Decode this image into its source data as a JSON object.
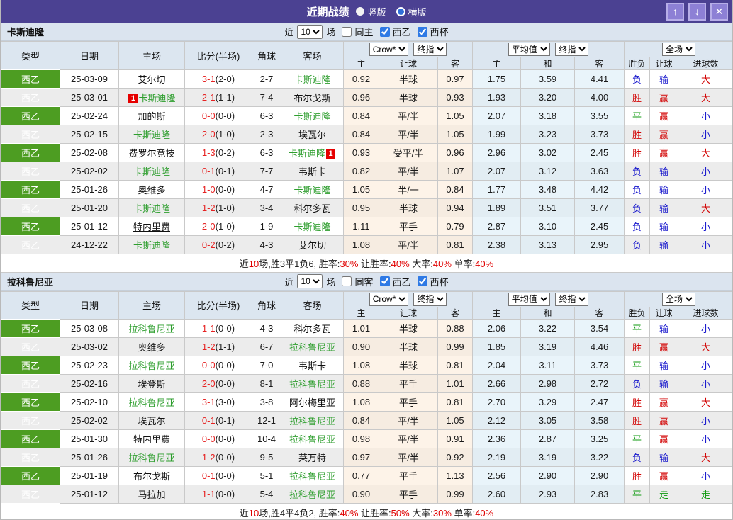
{
  "colors": {
    "purple": "#4b4192",
    "team_green": "#2e9e2e",
    "score_red": "#e62222",
    "badge_red": "#e60000",
    "summary_red": "#e00000",
    "result_red": "#d20000",
    "result_blue": "#1414cc",
    "result_green": "#0f9a0f"
  },
  "result_color_map": {
    "胜": "red",
    "赢": "red",
    "大": "red",
    "负": "blue",
    "输": "blue",
    "小": "blue",
    "平": "green",
    "走": "green"
  },
  "topbar": {
    "title": "近期战绩",
    "radio_vertical": "竖版",
    "radio_horizontal": "横版",
    "btn_up": "↑",
    "btn_down": "↓",
    "btn_close": "✕"
  },
  "headers": {
    "cols": [
      "类型",
      "日期",
      "主场",
      "比分(半场)",
      "角球",
      "客场"
    ],
    "odds_source": "Crow*",
    "odds_time": "终指",
    "avg_label": "平均值",
    "avg_time": "终指",
    "fulltime": "全场",
    "odds_cols": [
      "主",
      "让球",
      "客"
    ],
    "avg_cols": [
      "主",
      "和",
      "客"
    ],
    "result_cols": [
      "胜负",
      "让球",
      "进球数"
    ]
  },
  "sections": [
    {
      "team": "卡斯迪隆",
      "filter": {
        "prefix": "近",
        "count": "10",
        "suffix": "场",
        "same_label": "同主",
        "same_checked": false,
        "league_label": "西乙",
        "league_checked": true,
        "cup_label": "西杯",
        "cup_checked": true
      },
      "rows": [
        {
          "league": "西乙",
          "date": "25-03-09",
          "home": {
            "name": "艾尔切",
            "green": false
          },
          "score": "3-1",
          "half": "(2-0)",
          "corner": "2-7",
          "away": {
            "name": "卡斯迪隆",
            "green": true
          },
          "odds": [
            "0.92",
            "半球",
            "0.97"
          ],
          "avg": [
            "1.75",
            "3.59",
            "4.41"
          ],
          "results": [
            "负",
            "输",
            "大"
          ]
        },
        {
          "league": "西乙",
          "date": "25-03-01",
          "home": {
            "name": "卡斯迪隆",
            "green": true,
            "badge": "before",
            "badge_text": "1"
          },
          "score": "2-1",
          "half": "(1-1)",
          "corner": "7-4",
          "away": {
            "name": "布尔戈斯",
            "green": false
          },
          "odds": [
            "0.96",
            "半球",
            "0.93"
          ],
          "avg": [
            "1.93",
            "3.20",
            "4.00"
          ],
          "results": [
            "胜",
            "赢",
            "大"
          ]
        },
        {
          "league": "西乙",
          "date": "25-02-24",
          "home": {
            "name": "加的斯",
            "green": false
          },
          "score": "0-0",
          "half": "(0-0)",
          "corner": "6-3",
          "away": {
            "name": "卡斯迪隆",
            "green": true
          },
          "odds": [
            "0.84",
            "平/半",
            "1.05"
          ],
          "avg": [
            "2.07",
            "3.18",
            "3.55"
          ],
          "results": [
            "平",
            "赢",
            "小"
          ]
        },
        {
          "league": "西乙",
          "date": "25-02-15",
          "home": {
            "name": "卡斯迪隆",
            "green": true
          },
          "score": "2-0",
          "half": "(1-0)",
          "corner": "2-3",
          "away": {
            "name": "埃瓦尔",
            "green": false
          },
          "odds": [
            "0.84",
            "平/半",
            "1.05"
          ],
          "avg": [
            "1.99",
            "3.23",
            "3.73"
          ],
          "results": [
            "胜",
            "赢",
            "小"
          ]
        },
        {
          "league": "西乙",
          "date": "25-02-08",
          "home": {
            "name": "费罗尔竞技",
            "green": false
          },
          "score": "1-3",
          "half": "(0-2)",
          "corner": "6-3",
          "away": {
            "name": "卡斯迪隆",
            "green": true,
            "badge": "after",
            "badge_text": "1"
          },
          "odds": [
            "0.93",
            "受平/半",
            "0.96"
          ],
          "avg": [
            "2.96",
            "3.02",
            "2.45"
          ],
          "results": [
            "胜",
            "赢",
            "大"
          ]
        },
        {
          "league": "西乙",
          "date": "25-02-02",
          "home": {
            "name": "卡斯迪隆",
            "green": true
          },
          "score": "0-1",
          "half": "(0-1)",
          "corner": "7-7",
          "away": {
            "name": "韦斯卡",
            "green": false
          },
          "odds": [
            "0.82",
            "平/半",
            "1.07"
          ],
          "avg": [
            "2.07",
            "3.12",
            "3.63"
          ],
          "results": [
            "负",
            "输",
            "小"
          ]
        },
        {
          "league": "西乙",
          "date": "25-01-26",
          "home": {
            "name": "奥维多",
            "green": false
          },
          "score": "1-0",
          "half": "(0-0)",
          "corner": "4-7",
          "away": {
            "name": "卡斯迪隆",
            "green": true
          },
          "odds": [
            "1.05",
            "半/一",
            "0.84"
          ],
          "avg": [
            "1.77",
            "3.48",
            "4.42"
          ],
          "results": [
            "负",
            "输",
            "小"
          ]
        },
        {
          "league": "西乙",
          "date": "25-01-20",
          "home": {
            "name": "卡斯迪隆",
            "green": true
          },
          "score": "1-2",
          "half": "(1-0)",
          "corner": "3-4",
          "away": {
            "name": "科尔多瓦",
            "green": false
          },
          "odds": [
            "0.95",
            "半球",
            "0.94"
          ],
          "avg": [
            "1.89",
            "3.51",
            "3.77"
          ],
          "results": [
            "负",
            "输",
            "大"
          ]
        },
        {
          "league": "西乙",
          "date": "25-01-12",
          "home": {
            "name": "特内里费",
            "green": false,
            "underline": true
          },
          "score": "2-0",
          "half": "(1-0)",
          "corner": "1-9",
          "away": {
            "name": "卡斯迪隆",
            "green": true
          },
          "odds": [
            "1.11",
            "平手",
            "0.79"
          ],
          "avg": [
            "2.87",
            "3.10",
            "2.45"
          ],
          "results": [
            "负",
            "输",
            "小"
          ]
        },
        {
          "league": "西乙",
          "date": "24-12-22",
          "home": {
            "name": "卡斯迪隆",
            "green": true
          },
          "score": "0-2",
          "half": "(0-2)",
          "corner": "4-3",
          "away": {
            "name": "艾尔切",
            "green": false
          },
          "odds": [
            "1.08",
            "平/半",
            "0.81"
          ],
          "avg": [
            "2.38",
            "3.13",
            "2.95"
          ],
          "results": [
            "负",
            "输",
            "小"
          ]
        }
      ],
      "summary": [
        {
          "text": "近",
          "red": false
        },
        {
          "text": "10",
          "red": true
        },
        {
          "text": "场,胜3平1负6, 胜率:",
          "red": false
        },
        {
          "text": "30%",
          "red": true
        },
        {
          "text": " 让胜率:",
          "red": false
        },
        {
          "text": "40%",
          "red": true
        },
        {
          "text": " 大率:",
          "red": false
        },
        {
          "text": "40%",
          "red": true
        },
        {
          "text": " 单率:",
          "red": false
        },
        {
          "text": "40%",
          "red": true
        }
      ]
    },
    {
      "team": "拉科鲁尼亚",
      "filter": {
        "prefix": "近",
        "count": "10",
        "suffix": "场",
        "same_label": "同客",
        "same_checked": false,
        "league_label": "西乙",
        "league_checked": true,
        "cup_label": "西杯",
        "cup_checked": true
      },
      "rows": [
        {
          "league": "西乙",
          "date": "25-03-08",
          "home": {
            "name": "拉科鲁尼亚",
            "green": true
          },
          "score": "1-1",
          "half": "(0-0)",
          "corner": "4-3",
          "away": {
            "name": "科尔多瓦",
            "green": false
          },
          "odds": [
            "1.01",
            "半球",
            "0.88"
          ],
          "avg": [
            "2.06",
            "3.22",
            "3.54"
          ],
          "results": [
            "平",
            "输",
            "小"
          ]
        },
        {
          "league": "西乙",
          "date": "25-03-02",
          "home": {
            "name": "奥维多",
            "green": false
          },
          "score": "1-2",
          "half": "(1-1)",
          "corner": "6-7",
          "away": {
            "name": "拉科鲁尼亚",
            "green": true
          },
          "odds": [
            "0.90",
            "半球",
            "0.99"
          ],
          "avg": [
            "1.85",
            "3.19",
            "4.46"
          ],
          "results": [
            "胜",
            "赢",
            "大"
          ]
        },
        {
          "league": "西乙",
          "date": "25-02-23",
          "home": {
            "name": "拉科鲁尼亚",
            "green": true
          },
          "score": "0-0",
          "half": "(0-0)",
          "corner": "7-0",
          "away": {
            "name": "韦斯卡",
            "green": false
          },
          "odds": [
            "1.08",
            "半球",
            "0.81"
          ],
          "avg": [
            "2.04",
            "3.11",
            "3.73"
          ],
          "results": [
            "平",
            "输",
            "小"
          ]
        },
        {
          "league": "西乙",
          "date": "25-02-16",
          "home": {
            "name": "埃登斯",
            "green": false
          },
          "score": "2-0",
          "half": "(0-0)",
          "corner": "8-1",
          "away": {
            "name": "拉科鲁尼亚",
            "green": true
          },
          "odds": [
            "0.88",
            "平手",
            "1.01"
          ],
          "avg": [
            "2.66",
            "2.98",
            "2.72"
          ],
          "results": [
            "负",
            "输",
            "小"
          ]
        },
        {
          "league": "西乙",
          "date": "25-02-10",
          "home": {
            "name": "拉科鲁尼亚",
            "green": true
          },
          "score": "3-1",
          "half": "(3-0)",
          "corner": "3-8",
          "away": {
            "name": "阿尔梅里亚",
            "green": false
          },
          "odds": [
            "1.08",
            "平手",
            "0.81"
          ],
          "avg": [
            "2.70",
            "3.29",
            "2.47"
          ],
          "results": [
            "胜",
            "赢",
            "大"
          ]
        },
        {
          "league": "西乙",
          "date": "25-02-02",
          "home": {
            "name": "埃瓦尔",
            "green": false
          },
          "score": "0-1",
          "half": "(0-1)",
          "corner": "12-1",
          "away": {
            "name": "拉科鲁尼亚",
            "green": true
          },
          "odds": [
            "0.84",
            "平/半",
            "1.05"
          ],
          "avg": [
            "2.12",
            "3.05",
            "3.58"
          ],
          "results": [
            "胜",
            "赢",
            "小"
          ]
        },
        {
          "league": "西乙",
          "date": "25-01-30",
          "home": {
            "name": "特内里费",
            "green": false
          },
          "score": "0-0",
          "half": "(0-0)",
          "corner": "10-4",
          "away": {
            "name": "拉科鲁尼亚",
            "green": true
          },
          "odds": [
            "0.98",
            "平/半",
            "0.91"
          ],
          "avg": [
            "2.36",
            "2.87",
            "3.25"
          ],
          "results": [
            "平",
            "赢",
            "小"
          ]
        },
        {
          "league": "西乙",
          "date": "25-01-26",
          "home": {
            "name": "拉科鲁尼亚",
            "green": true
          },
          "score": "1-2",
          "half": "(0-0)",
          "corner": "9-5",
          "away": {
            "name": "莱万特",
            "green": false
          },
          "odds": [
            "0.97",
            "平/半",
            "0.92"
          ],
          "avg": [
            "2.19",
            "3.19",
            "3.22"
          ],
          "results": [
            "负",
            "输",
            "大"
          ]
        },
        {
          "league": "西乙",
          "date": "25-01-19",
          "home": {
            "name": "布尔戈斯",
            "green": false
          },
          "score": "0-1",
          "half": "(0-0)",
          "corner": "5-1",
          "away": {
            "name": "拉科鲁尼亚",
            "green": true
          },
          "odds": [
            "0.77",
            "平手",
            "1.13"
          ],
          "avg": [
            "2.56",
            "2.90",
            "2.90"
          ],
          "results": [
            "胜",
            "赢",
            "小"
          ]
        },
        {
          "league": "西乙",
          "date": "25-01-12",
          "home": {
            "name": "马拉加",
            "green": false
          },
          "score": "1-1",
          "half": "(0-0)",
          "corner": "5-4",
          "away": {
            "name": "拉科鲁尼亚",
            "green": true
          },
          "odds": [
            "0.90",
            "平手",
            "0.99"
          ],
          "avg": [
            "2.60",
            "2.93",
            "2.83"
          ],
          "results": [
            "平",
            "走",
            "走"
          ]
        }
      ],
      "summary": [
        {
          "text": "近",
          "red": false
        },
        {
          "text": "10",
          "red": true
        },
        {
          "text": "场,胜4平4负2, 胜率:",
          "red": false
        },
        {
          "text": "40%",
          "red": true
        },
        {
          "text": " 让胜率:",
          "red": false
        },
        {
          "text": "50%",
          "red": true
        },
        {
          "text": " 大率:",
          "red": false
        },
        {
          "text": "30%",
          "red": true
        },
        {
          "text": " 单率:",
          "red": false
        },
        {
          "text": "40%",
          "red": true
        }
      ]
    }
  ]
}
